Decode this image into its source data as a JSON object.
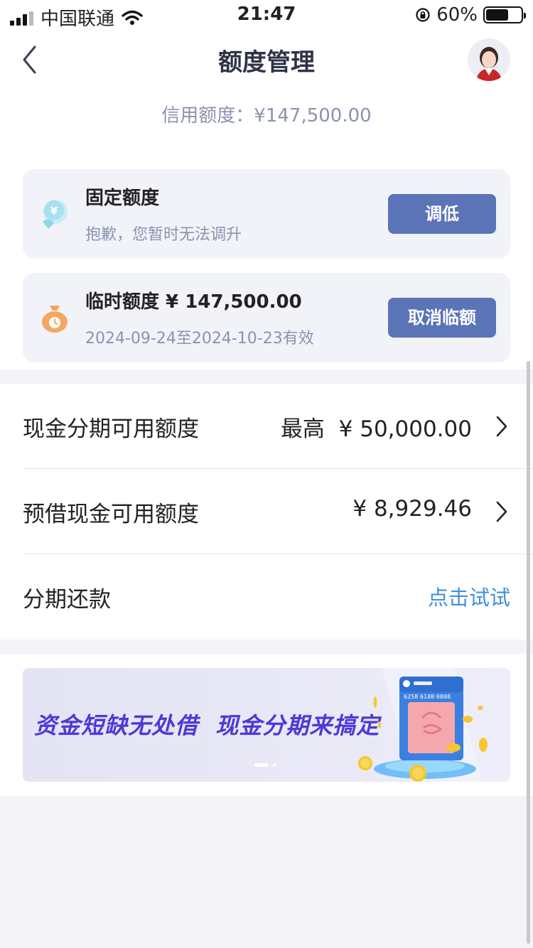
{
  "status_bar": {
    "carrier": "中国联通",
    "time": "21:47",
    "battery": "60%",
    "battery_level": 0.6
  },
  "nav": {
    "title": "额度管理"
  },
  "credit": {
    "line": "信用额度：¥147,500.00"
  },
  "fixed_quota": {
    "title": "固定额度",
    "subtitle": "抱歉，您暂时无法调升",
    "button": "调低"
  },
  "temp_quota": {
    "title": "临时额度 ¥ 147,500.00",
    "subtitle": "2024-09-24至2024-10-23有效",
    "button": "取消临额"
  },
  "list": {
    "cash_installment": {
      "label": "现金分期可用额度",
      "value": "最高  ¥ 50,000.00"
    },
    "cash_advance": {
      "label": "预借现金可用额度",
      "value": "¥ 8,929.46"
    },
    "installment_repay": {
      "label": "分期还款",
      "link": "点击试试"
    }
  },
  "banner": {
    "text": "资金短缺无处借  现金分期来搞定",
    "card_number": "6258  6188·8888",
    "slides": 2,
    "active_slide": 0
  },
  "colors": {
    "primary_button": "#5b74b8",
    "link": "#3f8fe0",
    "banner_text": "#4b3ad8",
    "muted_text": "#8b93ad"
  }
}
